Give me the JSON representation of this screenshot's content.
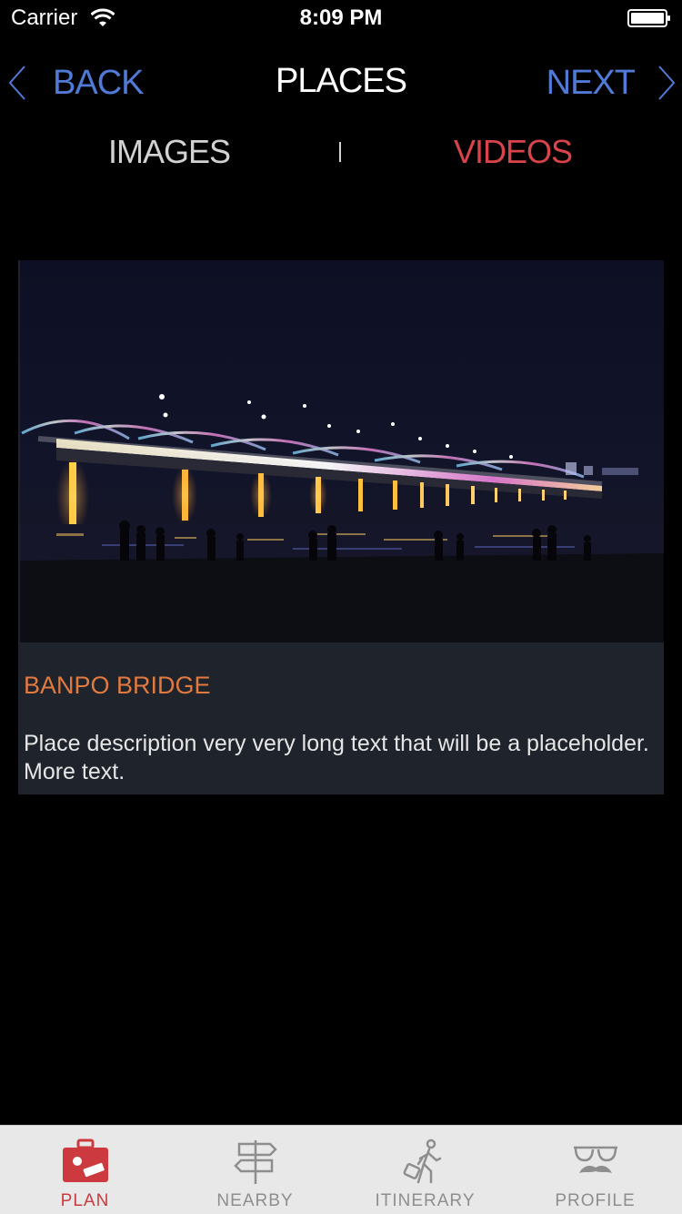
{
  "status_bar": {
    "carrier": "Carrier",
    "time": "8:09 PM"
  },
  "nav": {
    "back_label": "BACK",
    "title": "PLACES",
    "next_label": "NEXT",
    "accent_color": "#4f7bd6"
  },
  "segments": {
    "images_label": "IMAGES",
    "videos_label": "VIDEOS",
    "selected": "VIDEOS",
    "selected_color": "#d9434a"
  },
  "place": {
    "name": "BANPO BRIDGE",
    "description": "Place description very very long text that will be a placeholder. More text.",
    "name_color": "#e07a3f"
  },
  "tab_bar": {
    "items": [
      {
        "label": "PLAN",
        "icon": "suitcase-icon",
        "active": true
      },
      {
        "label": "NEARBY",
        "icon": "signpost-icon",
        "active": false
      },
      {
        "label": "ITINERARY",
        "icon": "traveler-icon",
        "active": false
      },
      {
        "label": "PROFILE",
        "icon": "glasses-mustache-icon",
        "active": false
      }
    ],
    "active_color": "#cc3a3f"
  }
}
